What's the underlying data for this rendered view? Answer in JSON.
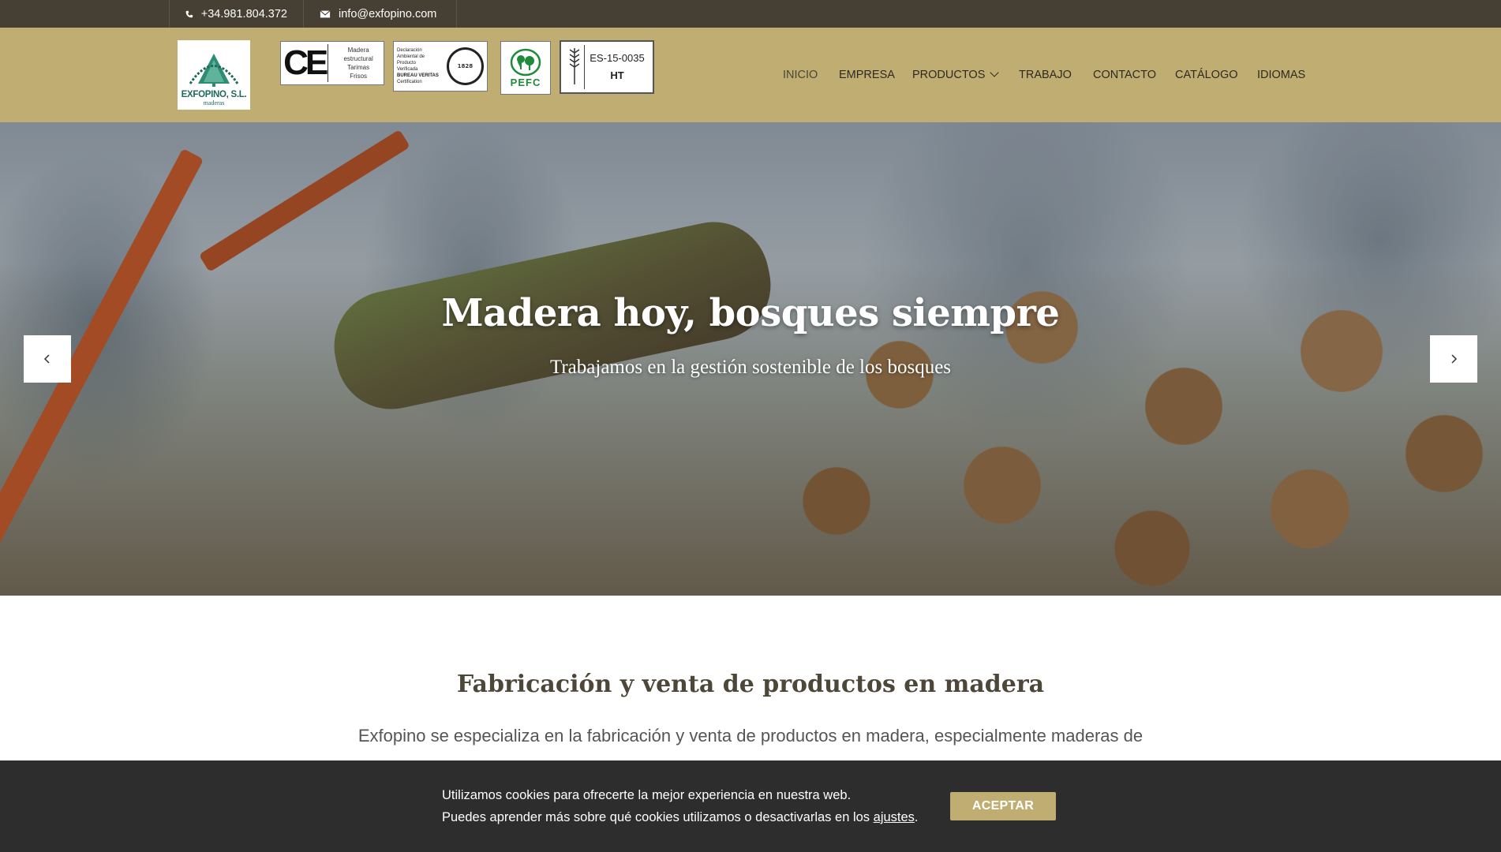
{
  "topbar": {
    "phone": "+34.981.804.372",
    "email": "info@exfopino.com"
  },
  "logo": {
    "name": "EXFOPINO, S.L.",
    "sub": "maderas"
  },
  "certifications": {
    "ce": {
      "mark": "CE",
      "line1": "Madera estructural",
      "line2": "Tarimas",
      "line3": "Frisos"
    },
    "bureau_veritas": {
      "line1": "Declaración",
      "line2": "Ambiental de Producto",
      "line3": "Verificada",
      "line4": "BUREAU VERITAS",
      "line5": "Certification",
      "seal": "1828"
    },
    "pefc": {
      "label": "PEFC"
    },
    "ippc": {
      "code": "ES-15-0035",
      "treatment": "HT",
      "side": "IPPC"
    }
  },
  "nav": {
    "items": [
      {
        "label": "INICIO"
      },
      {
        "label": "EMPRESA"
      },
      {
        "label": "PRODUCTOS"
      },
      {
        "label": "TRABAJO"
      },
      {
        "label": "CONTACTO"
      },
      {
        "label": "CATÁLOGO"
      },
      {
        "label": "IDIOMAS"
      }
    ]
  },
  "hero": {
    "title": "Madera hoy, bosques siempre",
    "subtitle": "Trabajamos en la gestión sostenible de los bosques"
  },
  "content": {
    "title": "Fabricación y venta de productos en madera",
    "text": "Exfopino se especializa en la fabricación y venta de productos en madera, especialmente maderas de"
  },
  "cookie": {
    "line1": "Utilizamos cookies para ofrecerte la mejor experiencia en nuestra web.",
    "line2_prefix": "Puedes aprender más sobre qué cookies utilizamos o desactivarlas en los",
    "link": "ajustes",
    "line2_suffix": ".",
    "accept": "ACEPTAR"
  },
  "colors": {
    "topbar": "#463f33",
    "header": "#c0ad72",
    "accent": "#c0ad72",
    "cookie_bg": "#2d2d2d"
  }
}
